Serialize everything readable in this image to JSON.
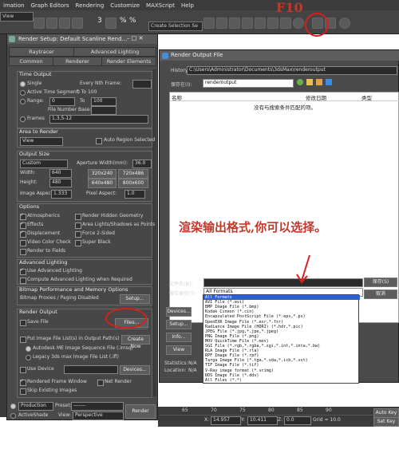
{
  "menubar": {
    "items": [
      "imation",
      "Graph Editors",
      "Rendering",
      "Customize",
      "MAXScript",
      "Help"
    ]
  },
  "toolbar": {
    "view_dropdown": "View",
    "selection_set": "Create Selection Se",
    "number_labels": [
      "3",
      "%",
      "%"
    ]
  },
  "render_setup": {
    "title": "Render Setup: Default Scanline Rend...",
    "tabs_row1": [
      "Raytracer",
      "Advanced Lighting"
    ],
    "tabs_row2": [
      "Common",
      "Renderer",
      "Render Elements"
    ],
    "time_output": {
      "header": "Time Output",
      "single": "Single",
      "every_nth": "Every Nth Frame:",
      "active_segment": "Active Time Segment:",
      "active_range": "0 To 100",
      "range": "Range:",
      "range_from": "0",
      "range_to_label": "To",
      "range_to": "100",
      "file_number_base": "File Number Base:",
      "frames": "Frames",
      "frames_value": "1,3,5-12"
    },
    "area_to_render": {
      "header": "Area to Render",
      "value": "View",
      "auto_region": "Auto Region Selected"
    },
    "output_size": {
      "header": "Output Size",
      "preset": "Custom",
      "aperture_label": "Aperture Width(mm):",
      "aperture_value": "36.0",
      "width_label": "Width:",
      "width_value": "640",
      "height_label": "Height:",
      "height_value": "480",
      "presets": [
        "320x240",
        "720x486",
        "640x480",
        "800x600"
      ],
      "image_aspect_label": "Image Aspect:",
      "image_aspect_value": "1.333",
      "pixel_aspect_label": "Pixel Aspect:",
      "pixel_aspect_value": "1.0"
    },
    "options": {
      "header": "Options",
      "items_left": [
        "Atmospherics",
        "Effects",
        "Displacement",
        "Video Color Check",
        "Render to Fields"
      ],
      "items_right": [
        "Render Hidden Geometry",
        "Area Lights/Shadows as Points",
        "Force 2-Sided",
        "Super Black"
      ]
    },
    "advanced_lighting": {
      "header": "Advanced Lighting",
      "use": "Use Advanced Lighting",
      "compute": "Compute Advanced Lighting when Required"
    },
    "bitmap": {
      "header": "Bitmap Performance and Memory Options",
      "label": "Bitmap Proxies / Paging Disabled",
      "setup": "Setup..."
    },
    "render_output": {
      "header": "Render Output",
      "save_file": "Save File",
      "files_button": "Files...",
      "put_image": "Put Image File List(s) in Output Path(s)",
      "create_now": "Create Now",
      "autodesk_seq": "Autodesk ME Image Sequence File (.imsq)",
      "legacy": "Legacy 3ds max Image File List (.ifl)",
      "use_device": "Use Device",
      "devices": "Devices...",
      "rendered_frame_window": "Rendered Frame Window",
      "net_render": "Net Render",
      "skip_existing": "Skip Existing Images"
    },
    "footer": {
      "production": "Production",
      "activeshade": "ActiveShade",
      "preset_label": "Preset:",
      "preset_value": "-------",
      "view_label": "View:",
      "view_value": "Perspective",
      "render_button": "Render"
    }
  },
  "render_output_file": {
    "title": "Render Output File",
    "history_label": "History:",
    "history_value": "C:\\Users\\Administrator\\Documents\\3dsMax\\renderoutput",
    "save_in_label": "保存在(I):",
    "save_in_value": "renderoutput",
    "columns": [
      "名称",
      "修改日期",
      "类型"
    ],
    "empty_message": "没有与搜索条件匹配的项。",
    "filename_label": "文件名(N):",
    "savetype_label": "保存类型(T):",
    "savetype_value": "All Formats",
    "save_button": "保存(S)",
    "cancel_button": "取消",
    "side_buttons": [
      "Devices...",
      "Setup...",
      "Info...",
      "View"
    ],
    "stats_label": "Statistics:",
    "stats_value": "N/A",
    "location_label": "Location:",
    "location_value": "N/A",
    "file_types": [
      "All Formats",
      "AVI File (*.avi)",
      "BMP Image File (*.bmp)",
      "Kodak Cineon (*.cin)",
      "Encapsulated PostScript File (*.eps,*.ps)",
      "OpenEXR Image File (*.exr,*.fxr)",
      "Radiance Image File (HDRI) (*.hdr,*.pic)",
      "JPEG File (*.jpg,*.jpe,*.jpeg)",
      "PNG Image File (*.png)",
      "MOV QuickTime File (*.mov)",
      "SGI File (*.rgb,*.rgba,*.sgi,*.int,*.inta,*.bw)",
      "RLA Image File (*.rla)",
      "RPF Image File (*.rpf)",
      "Targa Image File (*.tga,*.vda,*.icb,*.vst)",
      "TIF Image File (*.tif)",
      "V-Ray image format (*.vrimg)",
      "DDS Image File (*.dds)",
      "All Files (*.*)"
    ]
  },
  "annotations": {
    "top_note": "F10",
    "main_note": "渲染输出格式,你可以选择。"
  },
  "statusbar": {
    "numbers": [
      "65",
      "70",
      "75",
      "80",
      "85",
      "90"
    ],
    "x_label": "X:",
    "x_value": "14.957",
    "y_label": "Y:",
    "y_value": "10.411",
    "z_label": "Z:",
    "z_value": "0.0",
    "grid": "Grid = 10.0",
    "auto_key": "Auto Key",
    "set_key": "Set Key"
  },
  "colors": {
    "annotation": "#d4201f",
    "selection": "#2b5fd8"
  }
}
